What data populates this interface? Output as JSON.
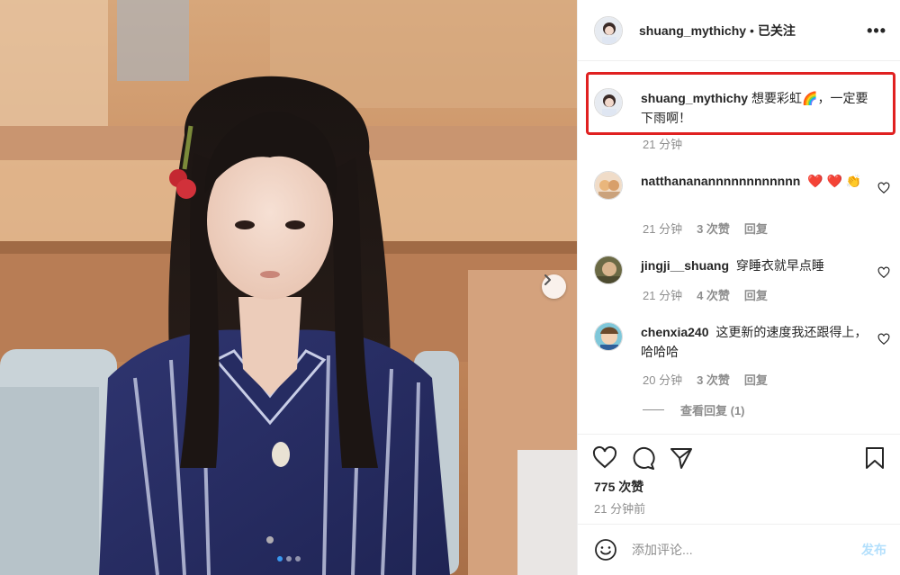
{
  "post": {
    "username": "shuang_mythichy",
    "follow_status": "已关注",
    "more_icon": "more-horizontal-icon"
  },
  "caption": {
    "username": "shuang_mythichy",
    "text": "想要彩虹🌈，一定要下雨啊！",
    "time": "21 分钟"
  },
  "comments": [
    {
      "username": "natthananannnnnnnnnnnn",
      "text": "❤️ ❤️ 👏",
      "time": "21 分钟",
      "likes": "3 次赞",
      "reply": "回复"
    },
    {
      "username": "jingji__shuang",
      "text": "穿睡衣就早点睡",
      "time": "21 分钟",
      "likes": "4 次赞",
      "reply": "回复"
    },
    {
      "username": "chenxia240",
      "text": "这更新的速度我还跟得上，哈哈哈",
      "time": "20 分钟",
      "likes": "3 次赞",
      "reply": "回复"
    }
  ],
  "view_replies": "查看回复 (1)",
  "stats": {
    "likes": "775 次赞",
    "posted": "21 分钟前"
  },
  "add_comment": {
    "placeholder": "添加评论...",
    "post_label": "发布"
  },
  "colors": {
    "highlight": "#e02121",
    "accent": "#3897f0",
    "post_button": "#b2dffc"
  }
}
